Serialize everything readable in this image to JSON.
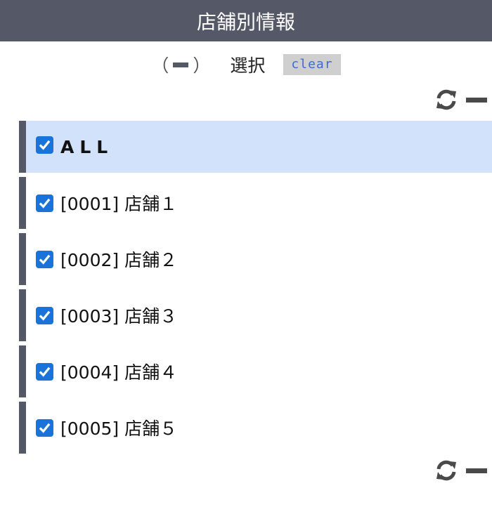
{
  "header": {
    "title": "店舗別情報"
  },
  "selection": {
    "paren_open": "（",
    "paren_close": "）",
    "label": "選択",
    "clear_label": "clear"
  },
  "stores": {
    "all_label": "ALL",
    "items": [
      {
        "label": "[0001] 店舗１",
        "checked": true
      },
      {
        "label": "[0002] 店舗２",
        "checked": true
      },
      {
        "label": "[0003] 店舗３",
        "checked": true
      },
      {
        "label": "[0004] 店舗４",
        "checked": true
      },
      {
        "label": "[0005] 店舗５",
        "checked": true
      }
    ]
  },
  "icons": {
    "refresh": "refresh-icon",
    "collapse": "minus-icon",
    "checkbox": "checkbox-checked-icon"
  },
  "colors": {
    "header_bg": "#555866",
    "checkbox": "#1a73d9",
    "all_row_bg": "#d2e2fb",
    "clear_text": "#3d6bd6"
  }
}
